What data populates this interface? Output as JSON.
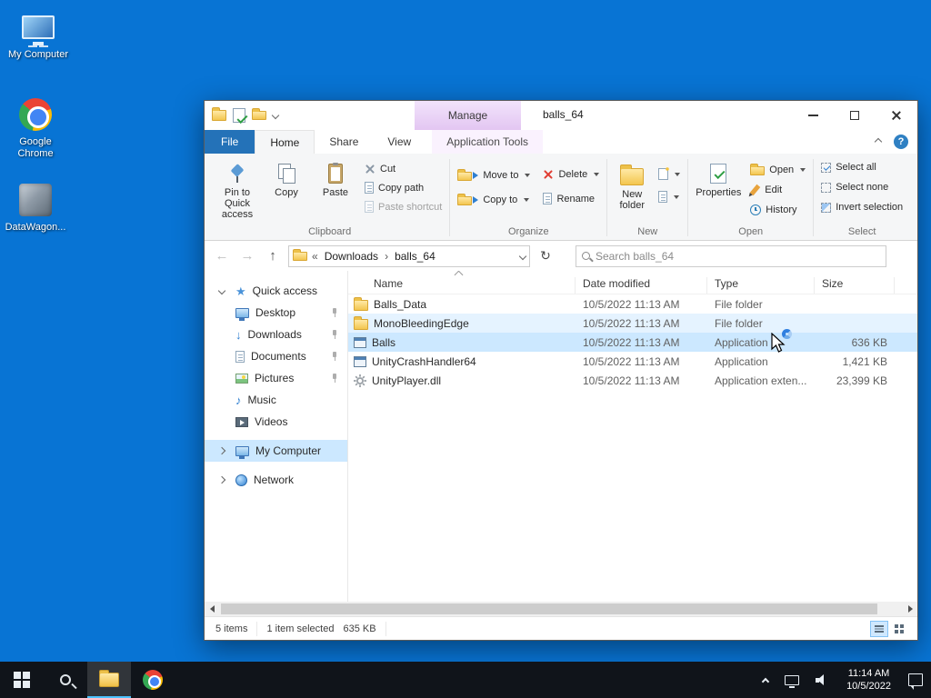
{
  "glyphs": {
    "back": "←",
    "forward": "→",
    "up": "↑",
    "refresh": "↻",
    "crumb_collapsed": "«",
    "crumb_sep": "›",
    "help": "?",
    "star": "★",
    "down_arrow": "↓",
    "music_note": "♪"
  },
  "desktop": {
    "icons": [
      {
        "label": "My Computer"
      },
      {
        "label": "Google Chrome"
      },
      {
        "label": "DataWagon..."
      }
    ]
  },
  "explorer": {
    "titlebar": {
      "title": "balls_64",
      "context_header": "Manage"
    },
    "tabs": {
      "file": "File",
      "home": "Home",
      "share": "Share",
      "view": "View",
      "context": "Application Tools"
    },
    "ribbon": {
      "pin": "Pin to Quick access",
      "copy": "Copy",
      "paste": "Paste",
      "cut": "Cut",
      "copy_path": "Copy path",
      "paste_shortcut": "Paste shortcut",
      "group_clipboard": "Clipboard",
      "move_to": "Move to",
      "copy_to": "Copy to",
      "delete": "Delete",
      "rename": "Rename",
      "group_organize": "Organize",
      "new_folder_line1": "New",
      "new_folder_line2": "folder",
      "group_new": "New",
      "properties": "Properties",
      "open": "Open",
      "edit": "Edit",
      "history": "History",
      "group_open": "Open",
      "select_all": "Select all",
      "select_none": "Select none",
      "invert_selection": "Invert selection",
      "group_select": "Select"
    },
    "address": {
      "crumbs": [
        "Downloads",
        "balls_64"
      ],
      "search_placeholder": "Search balls_64"
    },
    "sidebar": {
      "items": [
        {
          "label": "Quick access",
          "icon": "star-icon"
        },
        {
          "label": "Desktop",
          "icon": "monitor-icon",
          "pinned": true
        },
        {
          "label": "Downloads",
          "icon": "download-icon",
          "pinned": true
        },
        {
          "label": "Documents",
          "icon": "document-icon",
          "pinned": true
        },
        {
          "label": "Pictures",
          "icon": "picture-icon",
          "pinned": true
        },
        {
          "label": "Music",
          "icon": "music-icon"
        },
        {
          "label": "Videos",
          "icon": "video-icon"
        },
        {
          "label": "My Computer",
          "icon": "computer-icon",
          "selected": true
        },
        {
          "label": "Network",
          "icon": "network-icon"
        }
      ]
    },
    "files": {
      "columns": {
        "name": "Name",
        "date": "Date modified",
        "type": "Type",
        "size": "Size"
      },
      "rows": [
        {
          "name": "Balls_Data",
          "date": "10/5/2022 11:13 AM",
          "type": "File folder",
          "size": "",
          "icon": "folder-icon"
        },
        {
          "name": "MonoBleedingEdge",
          "date": "10/5/2022 11:13 AM",
          "type": "File folder",
          "size": "",
          "icon": "folder-icon"
        },
        {
          "name": "Balls",
          "date": "10/5/2022 11:13 AM",
          "type": "Application",
          "size": "636 KB",
          "icon": "application-icon"
        },
        {
          "name": "UnityCrashHandler64",
          "date": "10/5/2022 11:13 AM",
          "type": "Application",
          "size": "1,421 KB",
          "icon": "application-icon"
        },
        {
          "name": "UnityPlayer.dll",
          "date": "10/5/2022 11:13 AM",
          "type": "Application exten...",
          "size": "23,399 KB",
          "icon": "dll-icon"
        }
      ]
    },
    "statusbar": {
      "items_count": "5 items",
      "selection": "1 item selected",
      "selection_size": "635 KB"
    }
  },
  "taskbar": {
    "clock": {
      "time": "11:14 AM",
      "date": "10/5/2022"
    }
  }
}
